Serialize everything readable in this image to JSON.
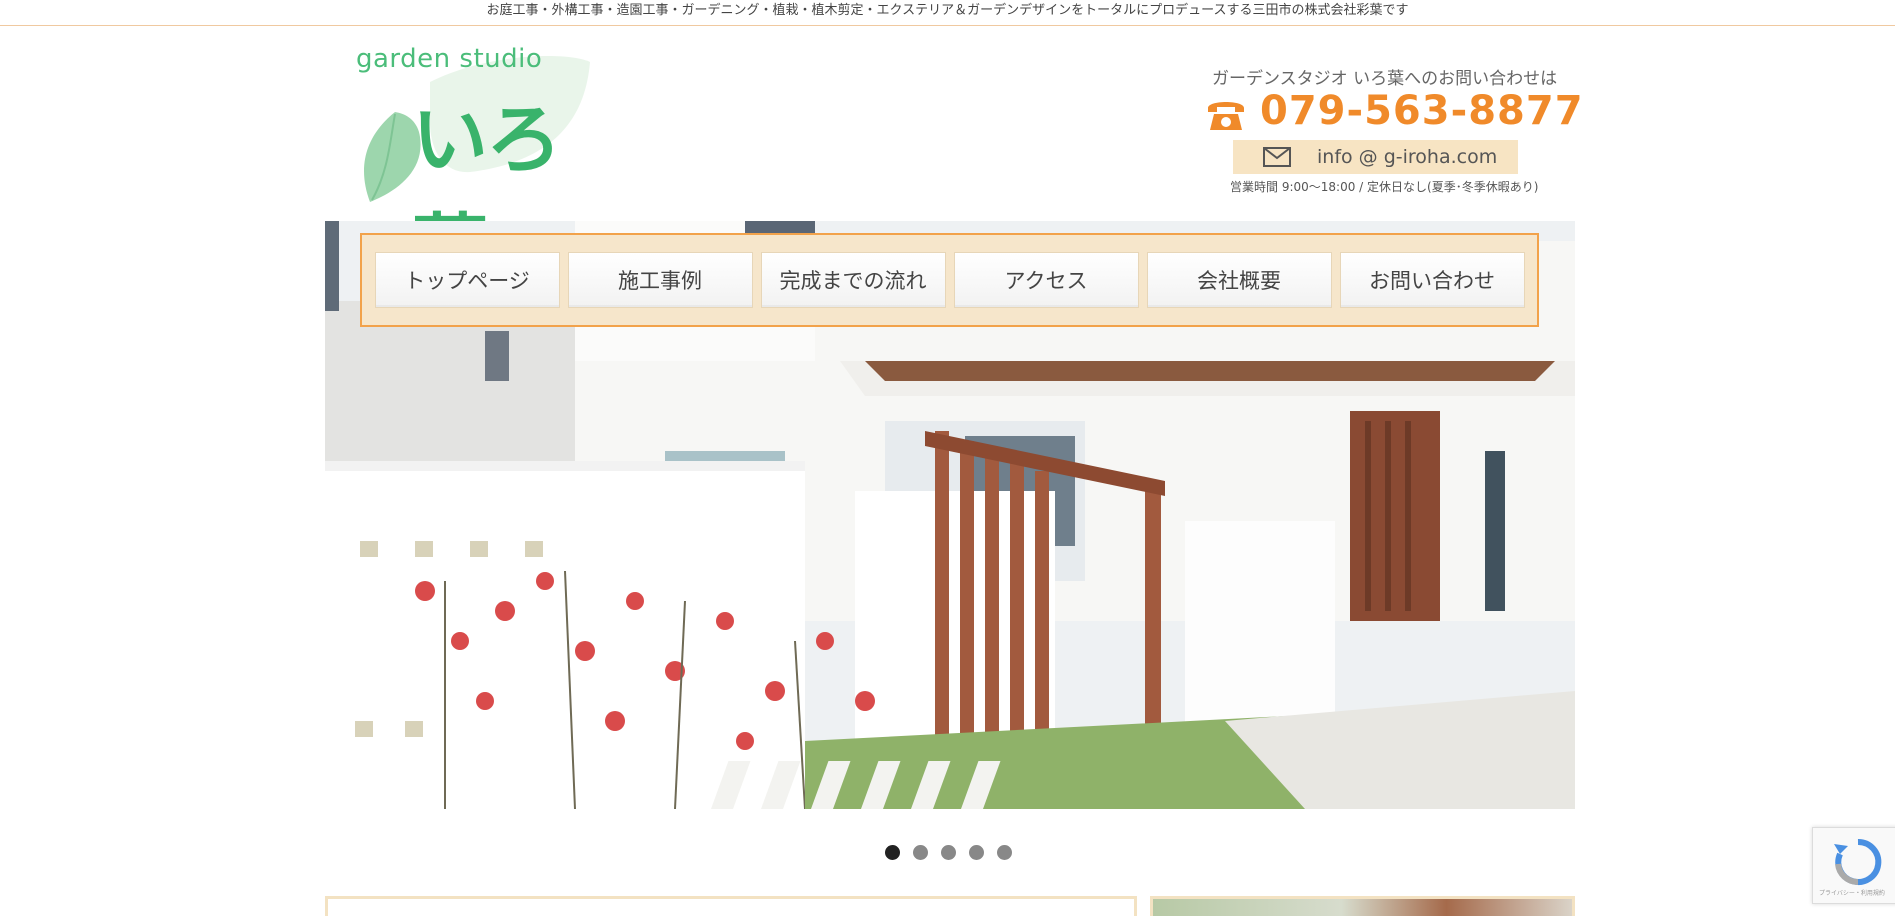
{
  "topbar": {
    "text": "お庭工事・外構工事・造園工事・ガーデニング・植栽・植木剪定・エクステリア＆ガーデンデザインをトータルにプロデュースする三田市の株式会社彩葉です"
  },
  "logo": {
    "english": "garden studio",
    "japanese": "いろ葉"
  },
  "contact": {
    "lead": "ガーデンスタジオ いろ葉へのお問い合わせは",
    "phone": "079-563-8877",
    "email": "info @ g-iroha.com",
    "hours": "営業時間 9:00〜18:00 / 定休日なし(夏季･冬季休暇あり)"
  },
  "nav": {
    "items": [
      {
        "label": "トップページ"
      },
      {
        "label": "施工事例"
      },
      {
        "label": "完成までの流れ"
      },
      {
        "label": "アクセス"
      },
      {
        "label": "会社概要"
      },
      {
        "label": "お問い合わせ"
      }
    ]
  },
  "slider": {
    "slide_count": 5,
    "active_index": 0
  },
  "recaptcha": {
    "label": "プライバシー・利用規約"
  },
  "colors": {
    "accent_orange": "#f08a2a",
    "nav_border": "#f2a24a",
    "nav_bg": "#f6e6cb",
    "logo_green": "#39b36b"
  }
}
